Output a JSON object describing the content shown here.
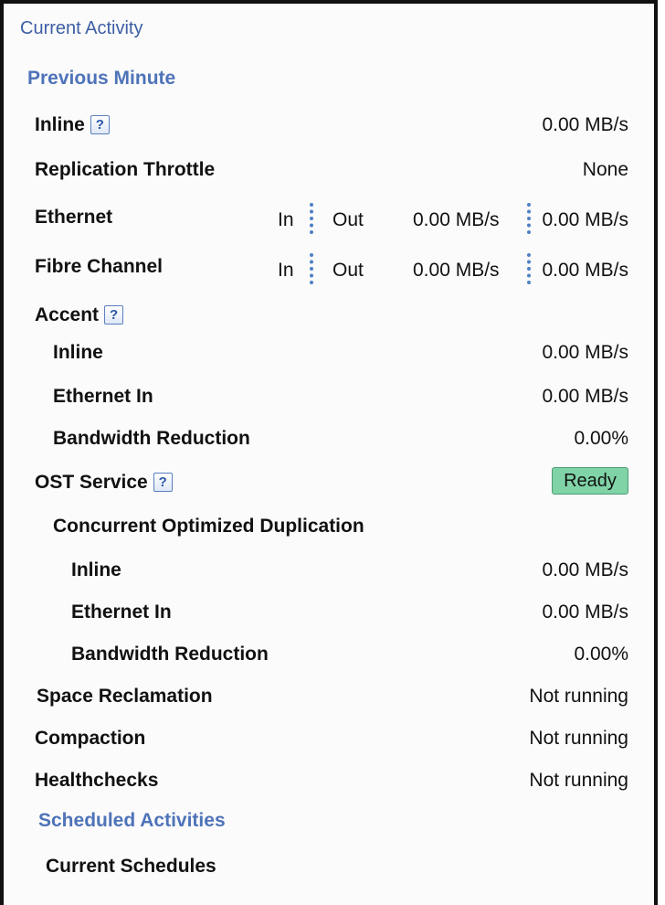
{
  "panel": {
    "title": "Current Activity",
    "previous_minute": "Previous Minute",
    "scheduled_activities": "Scheduled Activities"
  },
  "rows": {
    "inline": {
      "label": "Inline",
      "value": "0.00 MB/s"
    },
    "replication_throttle": {
      "label": "Replication Throttle",
      "value": "None"
    },
    "ethernet": {
      "label": "Ethernet",
      "in": "In",
      "out": "Out",
      "in_value": "0.00 MB/s",
      "out_value": "0.00 MB/s"
    },
    "fibre_channel": {
      "label": "Fibre Channel",
      "in": "In",
      "out": "Out",
      "in_value": "0.00 MB/s",
      "out_value": "0.00 MB/s"
    },
    "accent": {
      "label": "Accent"
    },
    "accent_inline": {
      "label": "Inline",
      "value": "0.00 MB/s"
    },
    "accent_ethernet_in": {
      "label": "Ethernet In",
      "value": "0.00 MB/s"
    },
    "accent_bandwidth_reduction": {
      "label": "Bandwidth Reduction",
      "value": "0.00%"
    },
    "ost_service": {
      "label": "OST Service",
      "status": "Ready"
    },
    "concurrent_optimized_duplication": {
      "label": "Concurrent Optimized Duplication"
    },
    "cod_inline": {
      "label": "Inline",
      "value": "0.00 MB/s"
    },
    "cod_ethernet_in": {
      "label": "Ethernet In",
      "value": "0.00 MB/s"
    },
    "cod_bandwidth_reduction": {
      "label": "Bandwidth Reduction",
      "value": "0.00%"
    },
    "space_reclamation": {
      "label": "Space Reclamation",
      "value": "Not running"
    },
    "compaction": {
      "label": "Compaction",
      "value": "Not running"
    },
    "healthchecks": {
      "label": "Healthchecks",
      "value": "Not running"
    },
    "current_schedules": {
      "label": "Current Schedules"
    }
  },
  "icons": {
    "help": "?"
  },
  "colors": {
    "section_blue": "#4e73b8",
    "ready_green": "#7fd3a6"
  }
}
